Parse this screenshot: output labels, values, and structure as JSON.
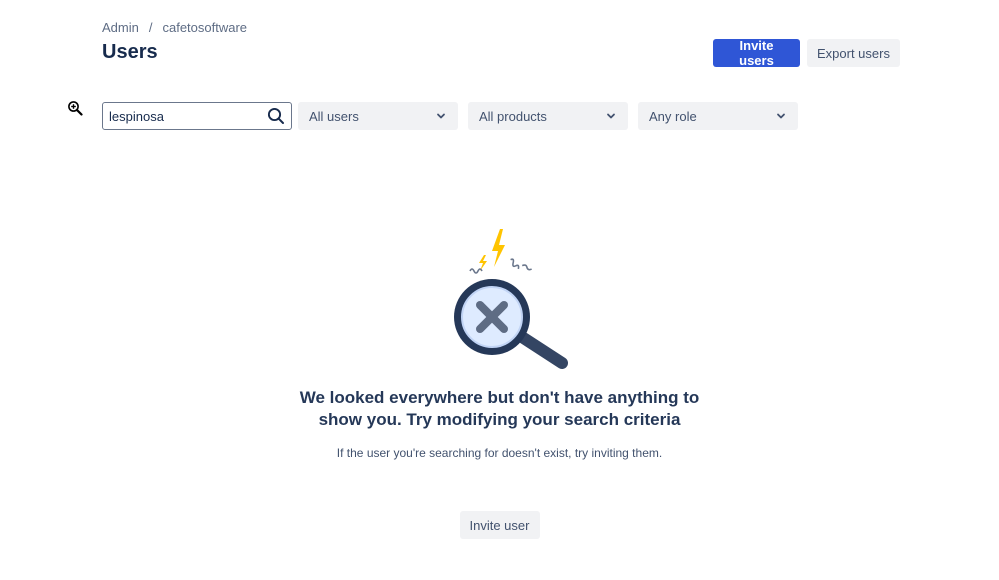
{
  "breadcrumb": {
    "items": [
      "Admin",
      "cafetosoftware"
    ],
    "separator": "/"
  },
  "header": {
    "title": "Users",
    "invite_label": "Invite users",
    "export_label": "Export users"
  },
  "filters": {
    "search_value": "lespinosa",
    "user_filter": "All users",
    "product_filter": "All products",
    "role_filter": "Any role"
  },
  "empty_state": {
    "heading_line1": "We looked everywhere but don't have anything to",
    "heading_line2": "show you. Try modifying your search criteria",
    "subtext": "If the user you're searching for doesn't exist, try inviting them.",
    "button_label": "Invite user"
  },
  "icons": {
    "cursor": "zoom-in-icon",
    "search": "search-icon",
    "dropdown": "chevron-down-icon",
    "illustration": "magnifier-no-results-icon"
  },
  "colors": {
    "primary": "#2f56d6",
    "text": "#172b4d",
    "muted": "#5e6c84",
    "button_bg": "#f1f2f4",
    "illustration_navy": "#253858",
    "illustration_yellow": "#ffc400"
  }
}
